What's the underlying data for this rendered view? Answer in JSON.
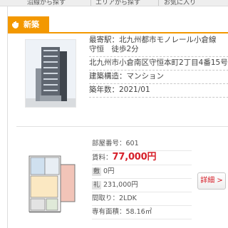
{
  "nav": {
    "tabs": [
      "沿線から探す",
      "エリアから探す",
      "お気に入り"
    ]
  },
  "badge": {
    "label": "新築",
    "color": "#f39800"
  },
  "listing": {
    "station": "最寄駅：北九州都市モノレール小倉線　守恒　徒歩2分",
    "address": "北九州市小倉南区守恒本町2丁目4番15号",
    "structure": "建築構造：マンション",
    "built": "築年数：2021/01"
  },
  "room": {
    "room_no": "部屋番号：601",
    "rent_label": "賃料：",
    "rent_value": "77,000円",
    "deposit_tag": "敷",
    "deposit_value": "0円",
    "key_money_tag": "礼",
    "key_money_value": "231,000円",
    "layout": "間取り：2LDK",
    "area": "専有面積：58.16㎡"
  },
  "detail_button": "詳細 >",
  "colors": {
    "accent": "#f39800",
    "price": "#d6202a"
  }
}
